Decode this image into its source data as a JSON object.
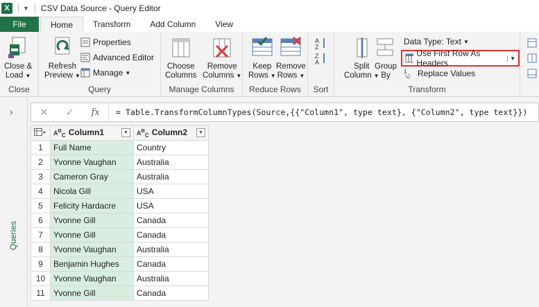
{
  "window": {
    "title": "CSV Data Source - Query Editor",
    "logo": "X"
  },
  "tabs": [
    "File",
    "Home",
    "Transform",
    "Add Column",
    "View"
  ],
  "ribbon": {
    "close": {
      "button": "Close &\nLoad",
      "line1": "Close &",
      "line2": "Load",
      "group": "Close"
    },
    "query": {
      "refresh1": "Refresh",
      "refresh2": "Preview",
      "properties": "Properties",
      "advanced": "Advanced Editor",
      "manage": "Manage",
      "group": "Query"
    },
    "columns": {
      "choose1": "Choose",
      "choose2": "Columns",
      "remove1": "Remove",
      "remove2": "Columns",
      "group": "Manage Columns"
    },
    "rows": {
      "keep1": "Keep",
      "keep2": "Rows",
      "remove1": "Remove",
      "remove2": "Rows",
      "group": "Reduce Rows"
    },
    "sort": {
      "group": "Sort"
    },
    "transform": {
      "split1": "Split",
      "split2": "Column",
      "groupby1": "Group",
      "groupby2": "By",
      "datatype": "Data Type: Text",
      "firstrow": "Use First Row As Headers",
      "replace": "Replace Values",
      "group": "Transform"
    }
  },
  "sidepane": {
    "label": "Queries"
  },
  "formula": "= Table.TransformColumnTypes(Source,{{\"Column1\", type text}, {\"Column2\", type text}})",
  "table": {
    "columns": [
      "Column1",
      "Column2"
    ],
    "rows": [
      [
        "1",
        "Full Name",
        "Country"
      ],
      [
        "2",
        "Yvonne Vaughan",
        "Australia"
      ],
      [
        "3",
        "Cameron Gray",
        "Australia"
      ],
      [
        "4",
        "Nicola Gill",
        "USA"
      ],
      [
        "5",
        "Felicity Hardacre",
        "USA"
      ],
      [
        "6",
        "Yvonne Gill",
        "Canada"
      ],
      [
        "7",
        "Yvonne Gill",
        "Canada"
      ],
      [
        "8",
        "Yvonne Vaughan",
        "Australia"
      ],
      [
        "9",
        "Benjamin Hughes",
        "Canada"
      ],
      [
        "10",
        "Yvonne Vaughan",
        "Australia"
      ],
      [
        "11",
        "Yvonne Gill",
        "Canada"
      ]
    ]
  },
  "colors": {
    "accent": "#217346",
    "highlight": "#e0302c",
    "column1_fill": "#d8eee0"
  }
}
